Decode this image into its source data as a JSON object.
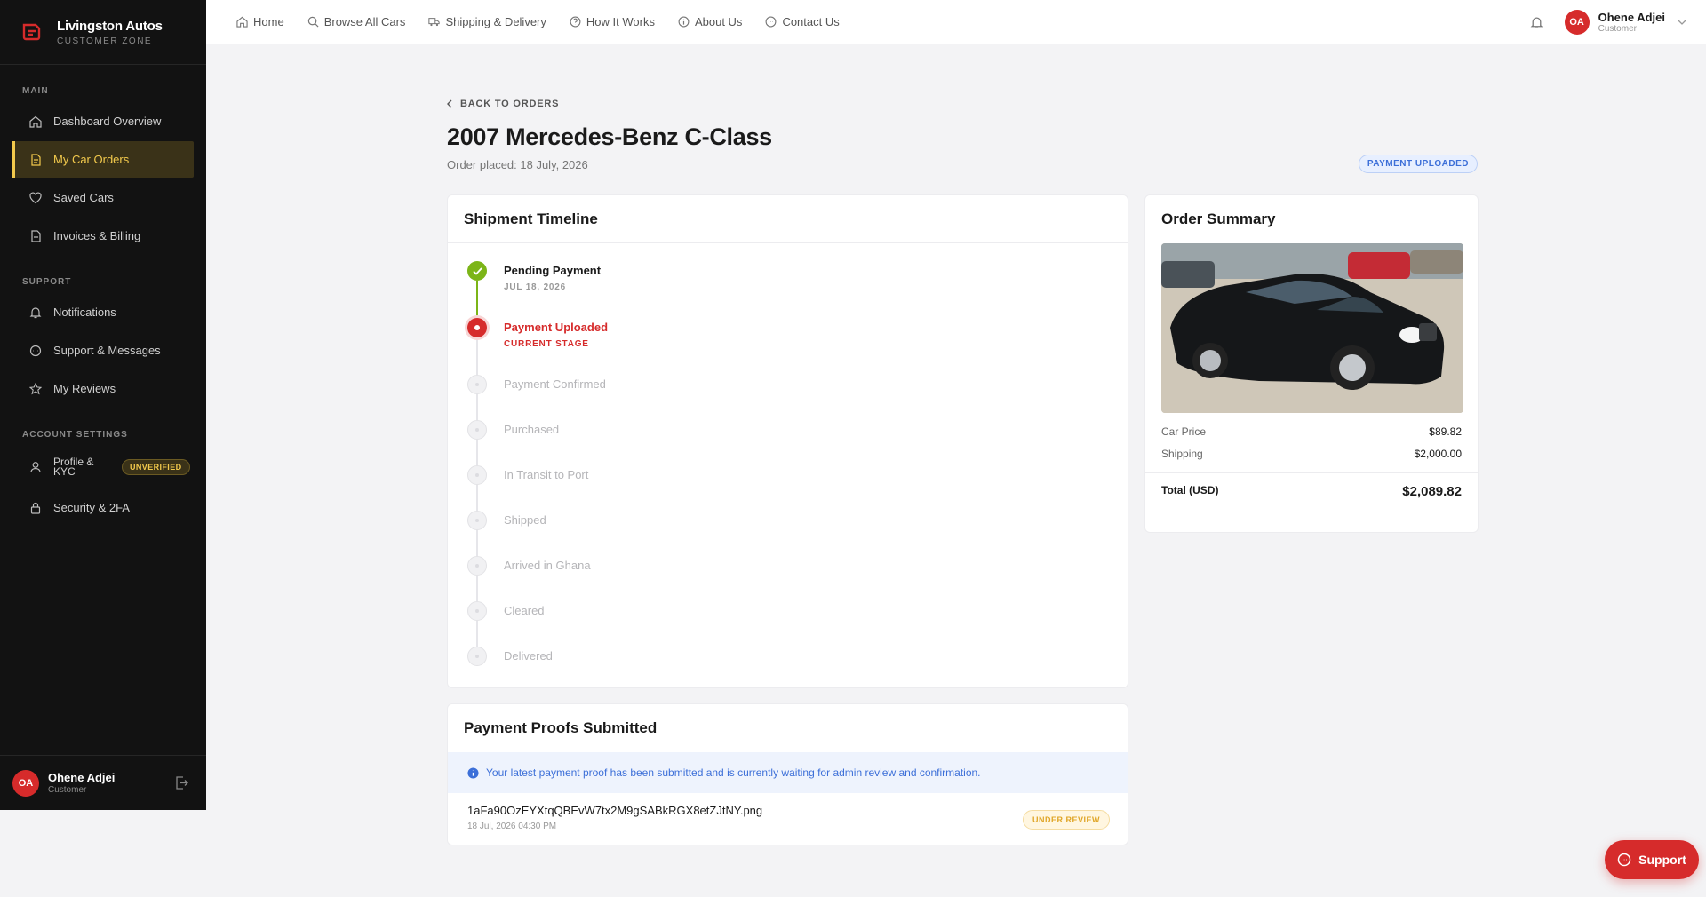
{
  "brand": {
    "name": "Livingston Autos",
    "sub": "CUSTOMER ZONE"
  },
  "sidebar": {
    "sections": [
      {
        "title": "MAIN",
        "items": [
          {
            "label": "Dashboard Overview",
            "icon": "home-icon"
          },
          {
            "label": "My Car Orders",
            "icon": "document-icon",
            "active": true
          },
          {
            "label": "Saved Cars",
            "icon": "heart-icon"
          },
          {
            "label": "Invoices & Billing",
            "icon": "invoice-icon"
          }
        ]
      },
      {
        "title": "SUPPORT",
        "items": [
          {
            "label": "Notifications",
            "icon": "bell-icon"
          },
          {
            "label": "Support & Messages",
            "icon": "chat-icon"
          },
          {
            "label": "My Reviews",
            "icon": "star-icon"
          }
        ]
      },
      {
        "title": "ACCOUNT SETTINGS",
        "items": [
          {
            "label": "Profile &\nKYC",
            "icon": "user-icon",
            "badge": "UNVERIFIED"
          },
          {
            "label": "Security & 2FA",
            "icon": "lock-icon"
          }
        ]
      }
    ],
    "footer": {
      "initials": "OA",
      "name": "Ohene Adjei",
      "role": "Customer"
    }
  },
  "topnav": {
    "links": [
      {
        "label": "Home",
        "icon": "home-icon"
      },
      {
        "label": "Browse All Cars",
        "icon": "search-icon"
      },
      {
        "label": "Shipping & Delivery",
        "icon": "truck-icon"
      },
      {
        "label": "How It Works",
        "icon": "help-icon"
      },
      {
        "label": "About Us",
        "icon": "info-icon"
      },
      {
        "label": "Contact Us",
        "icon": "chat-icon"
      }
    ],
    "user": {
      "initials": "OA",
      "name": "Ohene Adjei",
      "role": "Customer"
    }
  },
  "order": {
    "back_label": "BACK TO ORDERS",
    "title": "2007 Mercedes-Benz C-Class",
    "placed": "Order placed: 18 July, 2026",
    "status": "PAYMENT UPLOADED"
  },
  "timeline": {
    "title": "Shipment Timeline",
    "stages": [
      {
        "label": "Pending Payment",
        "sub": "JUL 18, 2026",
        "state": "done"
      },
      {
        "label": "Payment Uploaded",
        "sub": "CURRENT STAGE",
        "state": "current"
      },
      {
        "label": "Payment Confirmed",
        "sub": "",
        "state": "pending"
      },
      {
        "label": "Purchased",
        "sub": "",
        "state": "pending"
      },
      {
        "label": "In Transit to Port",
        "sub": "",
        "state": "pending"
      },
      {
        "label": "Shipped",
        "sub": "",
        "state": "pending"
      },
      {
        "label": "Arrived in Ghana",
        "sub": "",
        "state": "pending"
      },
      {
        "label": "Cleared",
        "sub": "",
        "state": "pending"
      },
      {
        "label": "Delivered",
        "sub": "",
        "state": "pending"
      }
    ]
  },
  "summary": {
    "title": "Order Summary",
    "car_price_label": "Car Price",
    "car_price": "$89.82",
    "shipping_label": "Shipping",
    "shipping": "$2,000.00",
    "total_label": "Total (USD)",
    "total": "$2,089.82"
  },
  "proofs": {
    "title": "Payment Proofs Submitted",
    "info": "Your latest payment proof has been submitted and is currently waiting for admin review and confirmation.",
    "file": "1aFa90OzEYXtqQBEvW7tx2M9gSABkRGX8etZJtNY.png",
    "date": "18 Jul, 2026 04:30 PM",
    "status": "UNDER REVIEW"
  },
  "support_button": "Support",
  "colors": {
    "accent": "#d62b2b",
    "active": "#f2c94c",
    "done": "#7cb518",
    "info": "#3c6fd8"
  }
}
